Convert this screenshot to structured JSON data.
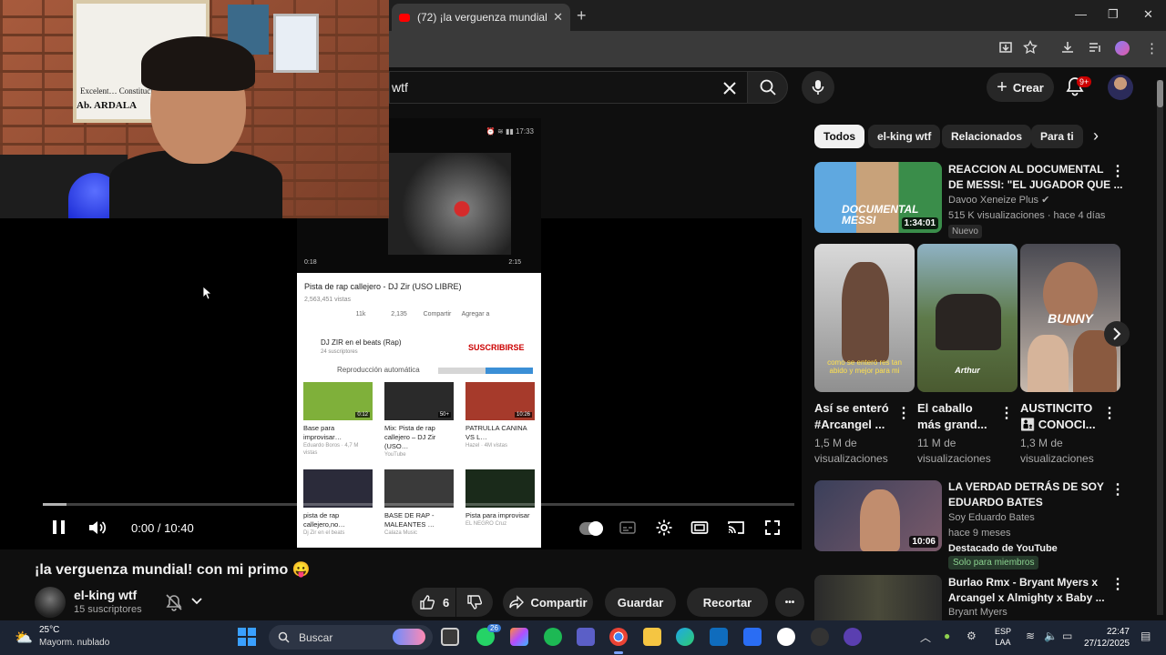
{
  "browser": {
    "tab_title": "(72) ¡la verguenza mundial! con mi primo",
    "tab_close": "✕",
    "new_tab": "+",
    "window_min": "—",
    "window_max": "❐",
    "window_close": "✕"
  },
  "youtube_header": {
    "search_value": "wtf",
    "create_label": "Crear",
    "notification_count": "9+"
  },
  "webcam": {
    "diploma_text": "Excelent… Constitucional…",
    "diploma_name": "Ab. ARDALA"
  },
  "phone_screen": {
    "status_text": "⏰ ≋ ▮▮ 17:33",
    "time_current": "0:18",
    "time_total": "2:15",
    "video_title": "Pista de rap callejero - DJ Zir (USO LIBRE)",
    "views": "2,563,451 vistas",
    "actions": [
      "11k",
      "2,135",
      "Compartir",
      "Agregar a"
    ],
    "channel": "DJ ZIR en el beats (Rap)",
    "channel_subs": "24 suscriptores",
    "subscribe_label": "SUSCRIBIRSE",
    "autoplay_label": "Reproducción automática",
    "cards": [
      {
        "caption": "Base para improvisar…",
        "sub": "Eduardo Boros · 4,7 M vistas",
        "badge": "0:12",
        "color": "#7fb03a"
      },
      {
        "caption": "Mix: Pista de rap callejero – DJ Zir (USO…",
        "sub": "YouTube",
        "badge": "50+",
        "color": "#2a2a2a"
      },
      {
        "caption": "PATRULLA CANINA VS L…",
        "sub": "Hazel · 4M vistas",
        "badge": "10:26",
        "color": "#a63a2b"
      },
      {
        "caption": "pista de rap callejero,no…",
        "sub": "Dj Zir en el beats",
        "badge": "",
        "color": "#2b2b3a"
      },
      {
        "caption": "BASE DE RAP - MALEANTES …",
        "sub": "Calaza Music",
        "badge": "",
        "color": "#3a3a3a"
      },
      {
        "caption": "Pista para improvisar",
        "sub": "EL NEGRO Cruz",
        "badge": "",
        "color": "#1a2a1a"
      }
    ]
  },
  "player": {
    "time": "0:00 / 10:40",
    "progress_played_fraction": 0
  },
  "video": {
    "title": "¡la verguenza mundial! con mi primo 😛",
    "channel": "el-king wtf",
    "subscribers": "15 suscriptores",
    "likes": "6",
    "share_label": "Compartir",
    "save_label": "Guardar",
    "clip_label": "Recortar",
    "more_label": "•••"
  },
  "chips": [
    "Todos",
    "el-king wtf",
    "Relacionados",
    "Para ti"
  ],
  "recommendations": [
    {
      "title_line1": "REACCION AL DOCUMENTAL",
      "title_line2": "DE MESSI: \"EL JUGADOR QUE ...",
      "channel": "Davoo Xeneize Plus ✔",
      "meta": "515 K visualizaciones · hace 4 días",
      "badge": "Nuevo",
      "duration": "1:34:01",
      "thumb_text": "DOCUMENTAL MESSI"
    },
    {
      "title_line1": "LA VERDAD DETRÁS DE SOY",
      "title_line2": "EDUARDO BATES",
      "channel": "Soy Eduardo Bates",
      "meta": "hace 9 meses",
      "featured": "Destacado de YouTube",
      "badge": "Solo para miembros",
      "duration": "10:06"
    },
    {
      "title_line1": "Burlao Rmx - Bryant Myers x",
      "title_line2": "Arcangel x Almighty x Baby ...",
      "channel": "Bryant Myers"
    }
  ],
  "shorts": [
    {
      "title1": "Así se enteró",
      "title2": "#Arcangel ...",
      "views1": "1,5 M de",
      "views2": "visualizaciones",
      "caption": "como se enteró res tan abido y mejor para mi"
    },
    {
      "title1": "El caballo",
      "title2": "más grand...",
      "views1": "11 M de",
      "views2": "visualizaciones",
      "caption": "Arthur"
    },
    {
      "title1": "AUSTINCITO",
      "title2": "👨‍👦 CONOCI...",
      "views1": "1,3 M de",
      "views2": "visualizaciones",
      "caption": "BUNNY"
    }
  ],
  "taskbar": {
    "temperature": "25°C",
    "weather": "Mayorm. nublado",
    "search_label": "Buscar",
    "whatsapp_badge": "26",
    "lang1": "ESP",
    "lang2": "LAA",
    "time": "22:47",
    "date": "27/12/2025"
  }
}
